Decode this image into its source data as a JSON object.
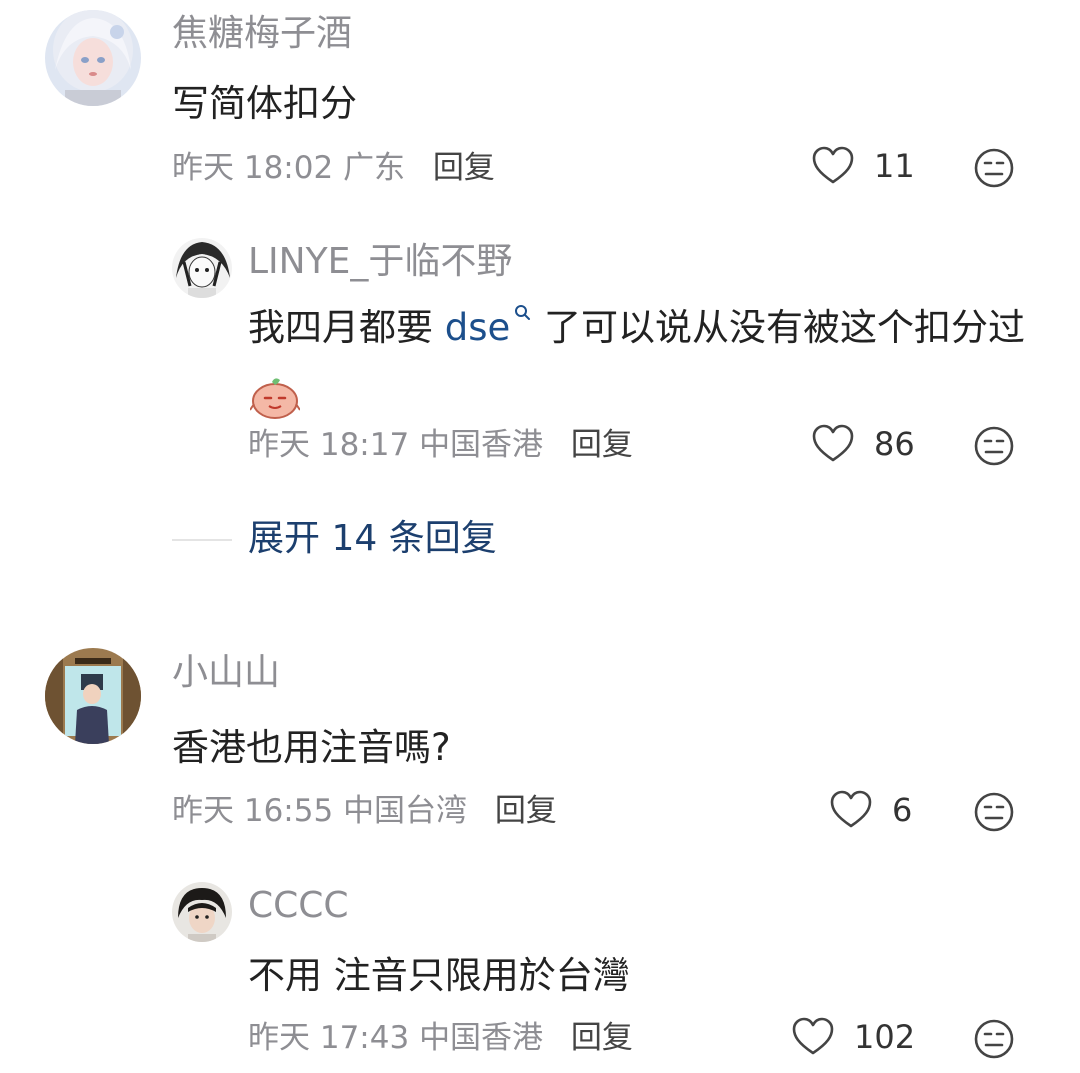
{
  "comments": [
    {
      "user": "焦糖梅子酒",
      "text": "写简体扣分",
      "time": "昨天 18:02",
      "location": "广东",
      "reply_label": "回复",
      "likes": "11",
      "replies": [
        {
          "user": "LINYE_于临不野",
          "text_before": "我四月都要 ",
          "link": "dse",
          "text_after": " 了可以说从没有被这个扣分过",
          "time": "昨天 18:17",
          "location": "中国香港",
          "reply_label": "回复",
          "likes": "86"
        }
      ],
      "expand_label": "展开 14 条回复"
    },
    {
      "user": "小山山",
      "text": "香港也用注音嗎?",
      "time": "昨天 16:55",
      "location": "中国台湾",
      "reply_label": "回复",
      "likes": "6",
      "replies": [
        {
          "user": "CCCC",
          "text": "不用 注音只限用於台灣",
          "time": "昨天 17:43",
          "location": "中国香港",
          "reply_label": "回复",
          "likes": "102"
        }
      ]
    }
  ],
  "icons": {
    "like": "heart-outline-icon",
    "dislike": "neutral-face-icon",
    "search": "search-icon",
    "emoji": "sticker-emoji-icon"
  },
  "colors": {
    "link": "#1c4f8c",
    "muted": "#8e8e93",
    "expand": "#1c3f6e"
  }
}
